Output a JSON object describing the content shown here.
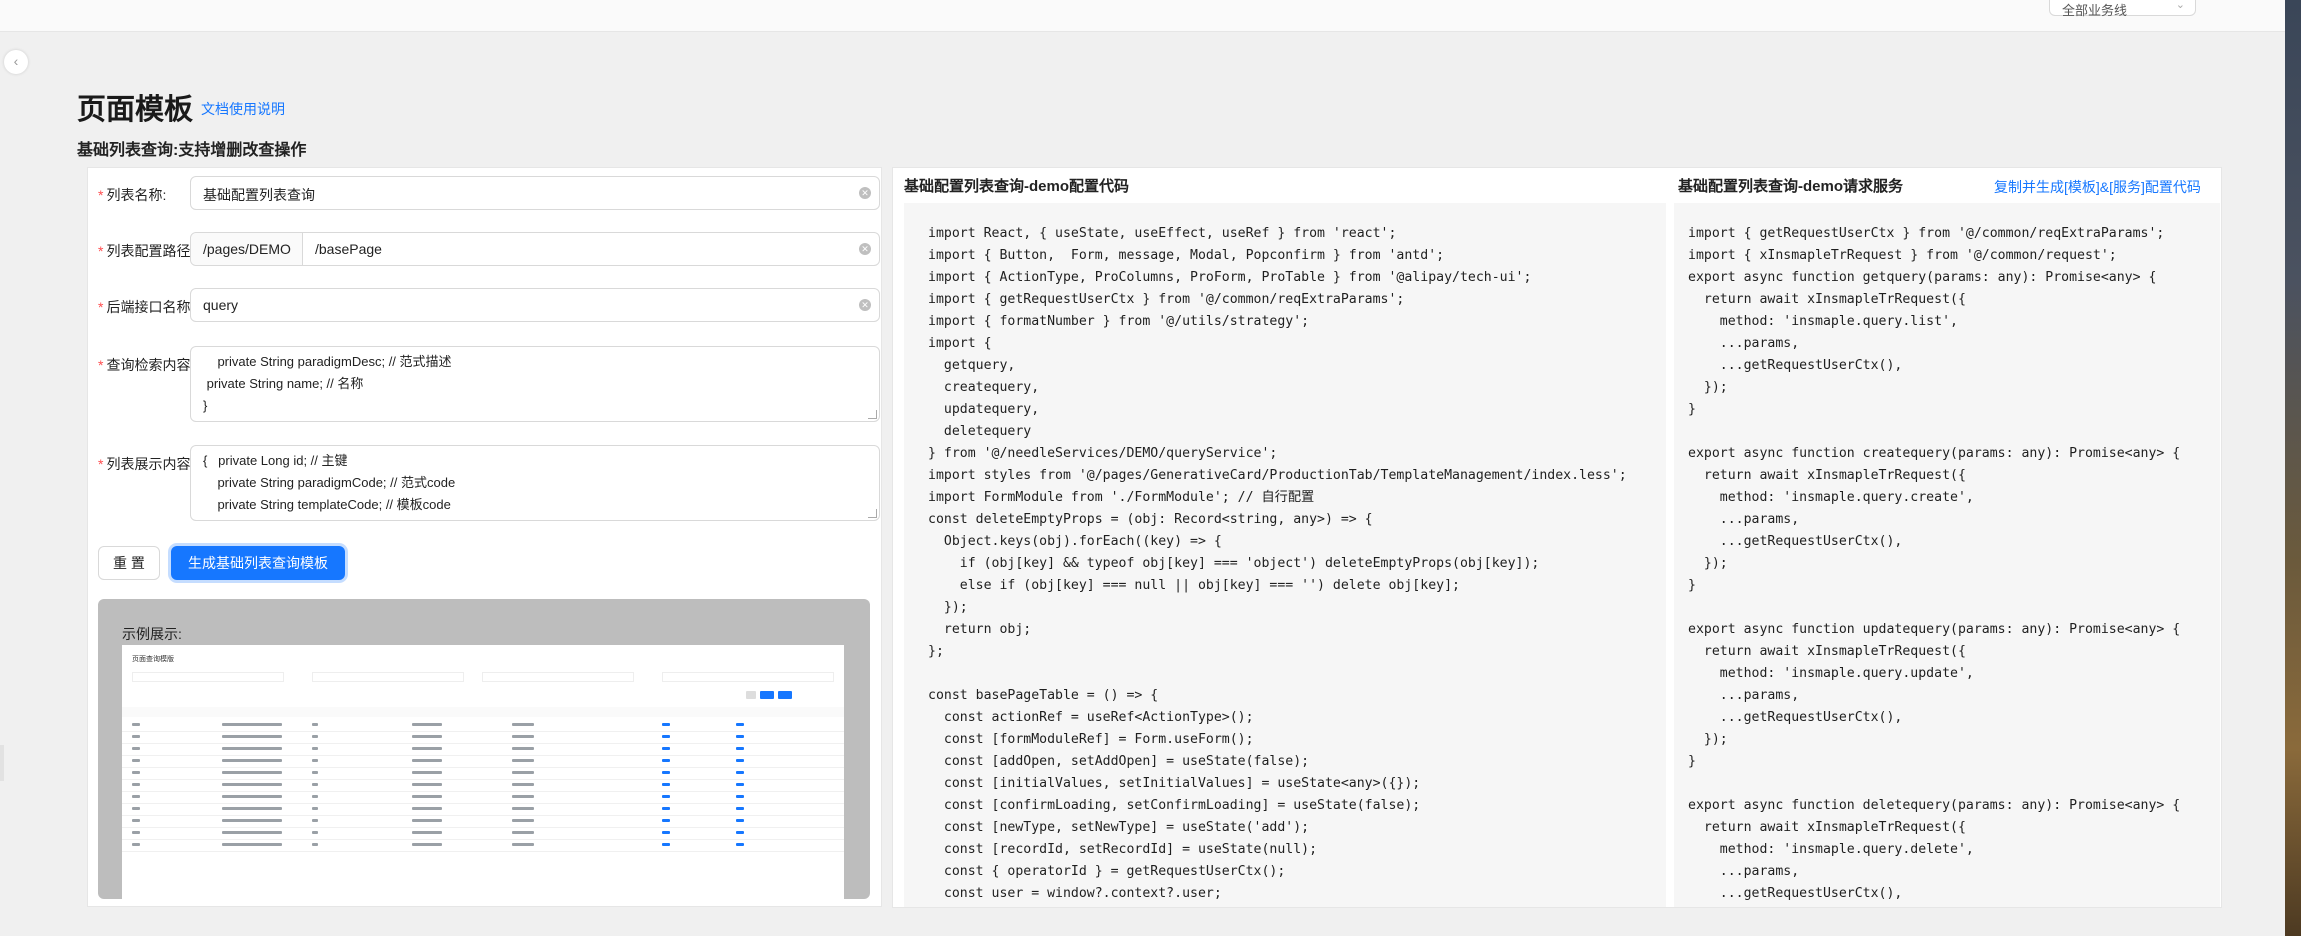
{
  "header": {
    "business_select": "全部业务线"
  },
  "page": {
    "title": "页面模板",
    "doc_link": "文档使用说明",
    "subtitle": "基础列表查询:支持增删改查操作"
  },
  "form": {
    "list_name": {
      "label": "列表名称:",
      "value": "基础配置列表查询"
    },
    "list_path": {
      "label": "列表配置路径:",
      "prefix": "/pages/DEMO",
      "value": "/basePage"
    },
    "api_name": {
      "label": "后端接口名称:",
      "value": "query"
    },
    "query_content": {
      "label": "查询检索内容:",
      "lines": [
        "    private String paradigmDesc; // 范式描述",
        " private String name; // 名称",
        "}"
      ]
    },
    "display_content": {
      "label": "列表展示内容:",
      "lines": [
        "{   private Long id; // 主键",
        "    private String paradigmCode; // 范式code",
        "    private String templateCode; // 模板code"
      ]
    },
    "reset_button": "重 置",
    "generate_button": "生成基础列表查询模板",
    "example_label": "示例展示:",
    "example_title": "页面查询模版"
  },
  "code": {
    "demo_title": "基础配置列表查询-demo配置代码",
    "service_title": "基础配置列表查询-demo请求服务",
    "copy_link": "复制并生成[模板]&[服务]配置代码",
    "demo_lines": [
      "import React, { useState, useEffect, useRef } from 'react';",
      "import { Button,  Form, message, Modal, Popconfirm } from 'antd';",
      "import { ActionType, ProColumns, ProForm, ProTable } from '@alipay/tech-ui';",
      "import { getRequestUserCtx } from '@/common/reqExtraParams';",
      "import { formatNumber } from '@/utils/strategy';",
      "import {",
      "  getquery,",
      "  createquery,",
      "  updatequery,",
      "  deletequery",
      "} from '@/needleServices/DEMO/queryService';",
      "import styles from '@/pages/GenerativeCard/ProductionTab/TemplateManagement/index.less';",
      "import FormModule from './FormModule'; // 自行配置",
      "const deleteEmptyProps = (obj: Record<string, any>) => {",
      "  Object.keys(obj).forEach((key) => {",
      "    if (obj[key] && typeof obj[key] === 'object') deleteEmptyProps(obj[key]);",
      "    else if (obj[key] === null || obj[key] === '') delete obj[key];",
      "  });",
      "  return obj;",
      "};",
      "",
      "const basePageTable = () => {",
      "  const actionRef = useRef<ActionType>();",
      "  const [formModuleRef] = Form.useForm();",
      "  const [addOpen, setAddOpen] = useState(false);",
      "  const [initialValues, setInitialValues] = useState<any>({});",
      "  const [confirmLoading, setConfirmLoading] = useState(false);",
      "  const [newType, setNewType] = useState('add');",
      "  const [recordId, setRecordId] = useState(null);",
      "  const { operatorId } = getRequestUserCtx();",
      "  const user = window?.context?.user;"
    ],
    "service_lines": [
      "import { getRequestUserCtx } from '@/common/reqExtraParams';",
      "import { xInsmapleTrRequest } from '@/common/request';",
      "export async function getquery(params: any): Promise<any> {",
      "  return await xInsmapleTrRequest({",
      "    method: 'insmaple.query.list',",
      "    ...params,",
      "    ...getRequestUserCtx(),",
      "  });",
      "}",
      "",
      "export async function createquery(params: any): Promise<any> {",
      "  return await xInsmapleTrRequest({",
      "    method: 'insmaple.query.create',",
      "    ...params,",
      "    ...getRequestUserCtx(),",
      "  });",
      "}",
      "",
      "export async function updatequery(params: any): Promise<any> {",
      "  return await xInsmapleTrRequest({",
      "    method: 'insmaple.query.update',",
      "    ...params,",
      "    ...getRequestUserCtx(),",
      "  });",
      "}",
      "",
      "export async function deletequery(params: any): Promise<any> {",
      "  return await xInsmapleTrRequest({",
      "    method: 'insmaple.query.delete',",
      "    ...params,",
      "    ...getRequestUserCtx(),"
    ]
  },
  "icons": {
    "collapse": "chevron-left-icon",
    "clear": "close-circle-icon",
    "select_arrow": "chevron-down-icon"
  },
  "colors": {
    "primary": "#1677ff",
    "required": "#ff4d4f",
    "code_bg": "#f6f6f6"
  }
}
